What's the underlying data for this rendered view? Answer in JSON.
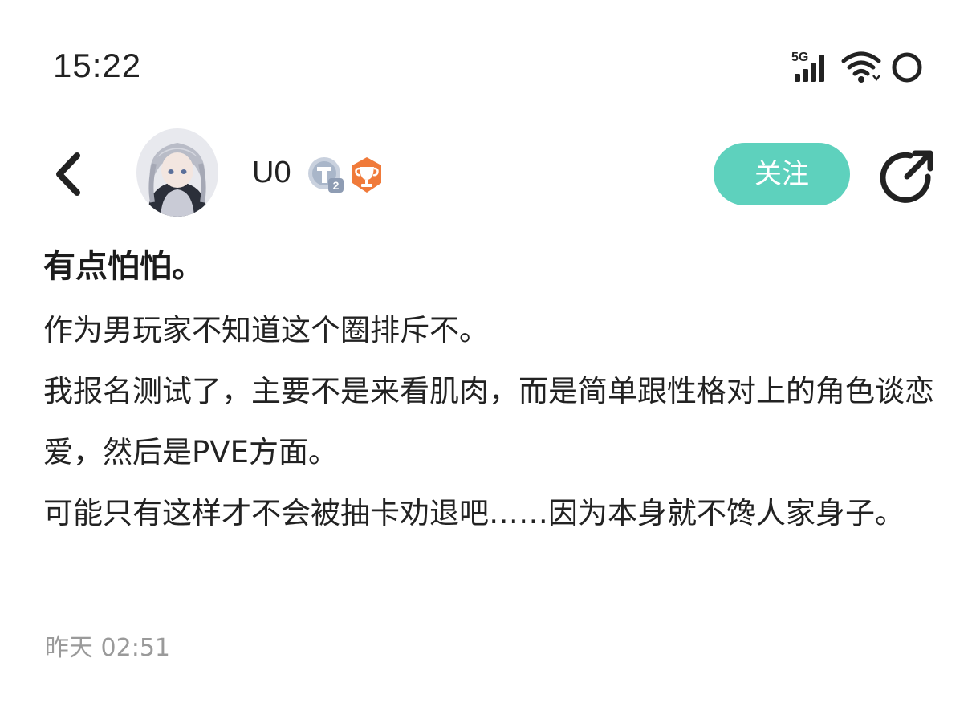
{
  "status_bar": {
    "time": "15:22",
    "network_label": "5G",
    "icons": [
      "signal-icon",
      "wifi-icon",
      "circle-icon"
    ]
  },
  "header": {
    "back_icon": "chevron-left-icon",
    "username": "U0",
    "level_badge": "T2",
    "trophy_badge": "trophy-icon",
    "follow_label": "关注",
    "share_icon": "share-icon"
  },
  "post": {
    "title": "有点怕怕。",
    "lines": [
      "作为男玩家不知道这个圈排斥不。",
      "我报名测试了，主要不是来看肌肉，而是简单跟性格对上的角色谈恋爱，然后是PVE方面。",
      "可能只有这样才不会被抽卡劝退吧……因为本身就不馋人家身子。"
    ],
    "timestamp": "昨天 02:51"
  },
  "colors": {
    "follow_button": "#5ed1bd",
    "trophy_badge": "#f07a3a",
    "level_badge": "#a9b6c9",
    "timestamp": "#9a9a9a"
  }
}
